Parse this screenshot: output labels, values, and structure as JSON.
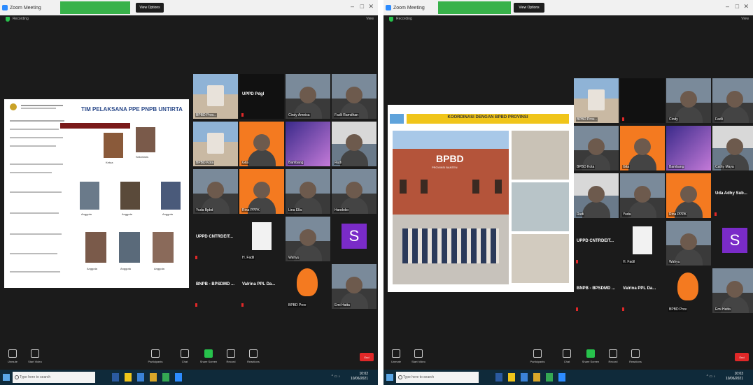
{
  "shots": [
    {
      "app_title": "Zoom Meeting",
      "talking_label": "",
      "view_options": "View Options",
      "window_controls": [
        "–",
        "□",
        "✕"
      ],
      "recording": "Recording",
      "view_button": "View",
      "slide": {
        "title": "TIM PELAKSANA PPE PNPB UNTIRTA",
        "role_labels": [
          "Ketua",
          "Sekretaris",
          "Anggota",
          "Anggota",
          "Anggota",
          "Anggota",
          "Anggota",
          "Anggota"
        ]
      },
      "tiles": [
        {
          "name": "BPBD Prov...",
          "kind": "building"
        },
        {
          "name": "UPPD Pdgl",
          "kind": "dark"
        },
        {
          "name": "Cindy Amnisa",
          "kind": "person"
        },
        {
          "name": "Fadli Ramdhan",
          "kind": "person"
        },
        {
          "name": "BPBD Kota",
          "kind": "building"
        },
        {
          "name": "Gita",
          "kind": "orange"
        },
        {
          "name": "Bambang",
          "kind": "purple"
        },
        {
          "name": "Rudi",
          "kind": "room"
        },
        {
          "name": "Yuda Bpbd",
          "kind": "person"
        },
        {
          "name": "Rina PPPK",
          "kind": "orange"
        },
        {
          "name": "Lina Ella",
          "kind": "person"
        },
        {
          "name": "Handoko",
          "kind": "person"
        },
        {
          "name": "UPPD CNTRDEIT...",
          "kind": "text"
        },
        {
          "name": "H. Fadil",
          "kind": "tower"
        },
        {
          "name": "Wahyu",
          "kind": "person"
        },
        {
          "name": "S",
          "kind": "letter"
        },
        {
          "name": "BNPB - BPSDMD ...",
          "kind": "text"
        },
        {
          "name": "Valrina PPL Da...",
          "kind": "text"
        },
        {
          "name": "BPBD Prov",
          "kind": "logo"
        },
        {
          "name": "Emi Hatta",
          "kind": "person"
        }
      ],
      "toolbar": [
        "Unmute",
        "Start Video",
        "Participants",
        "Chat",
        "Share Screen",
        "Record",
        "Reactions"
      ],
      "end_label": "End",
      "search_placeholder": "Type here to search",
      "clock_time": "10:02",
      "clock_date": "10/06/2021"
    },
    {
      "app_title": "Zoom Meeting",
      "talking_label": "",
      "view_options": "View Options",
      "window_controls": [
        "–",
        "□",
        "✕"
      ],
      "recording": "Recording",
      "view_button": "View",
      "slide": {
        "title": "KOORDINASI DENGAN BPBD PROVINSI",
        "building_text": "BPBD",
        "building_sub": "PROVINSI BANTEN"
      },
      "tiles": [
        {
          "name": "BPBD Prov...",
          "kind": "building"
        },
        {
          "name": "",
          "kind": "dark"
        },
        {
          "name": "Cindy",
          "kind": "person"
        },
        {
          "name": "Fadli",
          "kind": "person"
        },
        {
          "name": "BPBD Kota",
          "kind": "person"
        },
        {
          "name": "Gita",
          "kind": "orange"
        },
        {
          "name": "Bambang",
          "kind": "purple"
        },
        {
          "name": "Cathy Maya",
          "kind": "room"
        },
        {
          "name": "Rudi",
          "kind": "room"
        },
        {
          "name": "Yuda",
          "kind": "person"
        },
        {
          "name": "Rina PPPK",
          "kind": "orange"
        },
        {
          "name": "Uda Adhy Sub...",
          "kind": "text"
        },
        {
          "name": "UPPD CNTRDEIT...",
          "kind": "text"
        },
        {
          "name": "H. Fadil",
          "kind": "tower"
        },
        {
          "name": "Wahyu",
          "kind": "person"
        },
        {
          "name": "S",
          "kind": "letter"
        },
        {
          "name": "BNPB - BPSDMD ...",
          "kind": "text"
        },
        {
          "name": "Valrina PPL Da...",
          "kind": "text"
        },
        {
          "name": "BPBD Prov",
          "kind": "logo"
        },
        {
          "name": "Emi Hatta",
          "kind": "person"
        }
      ],
      "toolbar": [
        "Unmute",
        "Start Video",
        "Participants",
        "Chat",
        "Share Screen",
        "Record",
        "Reactions"
      ],
      "end_label": "End",
      "search_placeholder": "Type here to search",
      "clock_time": "10:03",
      "clock_date": "10/06/2021"
    }
  ],
  "colors": {
    "zoom_blue": "#2d8cff",
    "talking_green": "#38b24a",
    "end_red": "#e02828",
    "meeting_bg": "#1b1b1b",
    "tile_orange": "#f47a20",
    "tile_purple": "#7a2bc8",
    "slide_yellow": "#f0c51a",
    "slide_blue": "#5fa3db",
    "building_brick": "#b4543a"
  }
}
